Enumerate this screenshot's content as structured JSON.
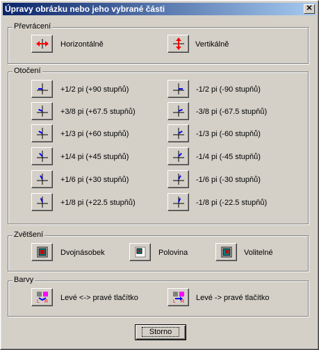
{
  "window": {
    "title": "Úpravy obrázku nebo jeho vybrané části",
    "close_label": "✕"
  },
  "flip": {
    "title": "Převrácení",
    "horizontal": "Horizontálně",
    "vertical": "Vertikálně"
  },
  "rotate": {
    "title": "Otočení",
    "left": [
      "+1/2 pi (+90 stupňů)",
      "+3/8 pi (+67.5 stupňů)",
      "+1/3 pi (+60 stupňů)",
      "+1/4 pi (+45 stupňů)",
      "+1/6 pi (+30 stupňů)",
      "+1/8 pi (+22.5 stupňů)"
    ],
    "right": [
      "-1/2 pi (-90 stupňů)",
      "-3/8 pi (-67.5 stupňů)",
      "-1/3 pi (-60 stupňů)",
      "-1/4 pi (-45 stupňů)",
      "-1/6 pi (-30 stupňů)",
      "-1/8 pi (-22.5 stupňů)"
    ]
  },
  "zoom": {
    "title": "Zvětšení",
    "double": "Dvojnásobek",
    "half": "Polovina",
    "custom": "Volitelné"
  },
  "colors": {
    "title": "Barvy",
    "swap": "Levé <-> pravé tlačítko",
    "copy": "Levé -> pravé tlačítko"
  },
  "footer": {
    "cancel": "Storno"
  },
  "accent": {
    "red": "#ff0000",
    "blue": "#0000ff",
    "title_start": "#0a246a",
    "title_end": "#a6caf0"
  }
}
